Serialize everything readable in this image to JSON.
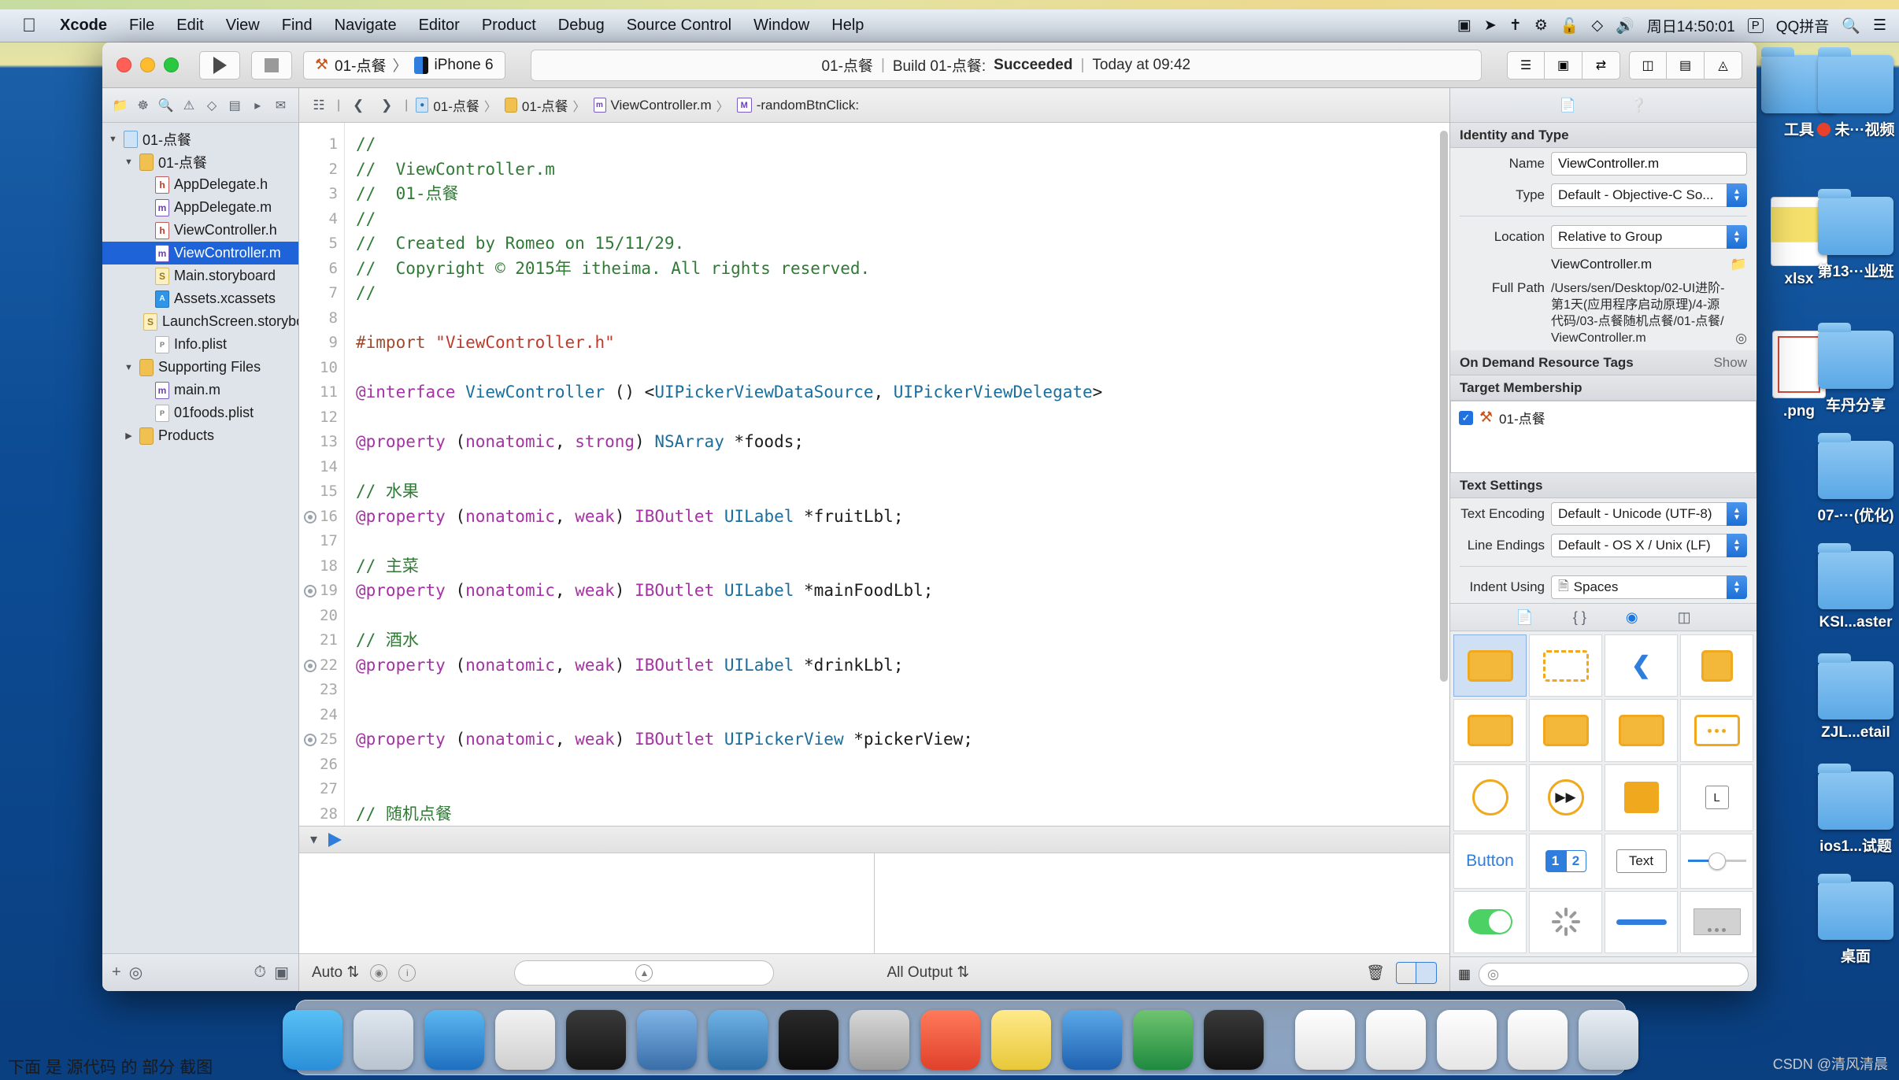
{
  "menubar": {
    "apple_icon": "apple-logo",
    "items": [
      "Xcode",
      "File",
      "Edit",
      "View",
      "Find",
      "Navigate",
      "Editor",
      "Product",
      "Debug",
      "Source Control",
      "Window",
      "Help"
    ],
    "status_icons": [
      "screen-recording-icon",
      "location-arrow-icon",
      "airplay-icon",
      "bluetooth-icon",
      "lock-icon",
      "dropbox-icon",
      "volume-icon"
    ],
    "clock": "周日14:50:01",
    "input_source": "QQ拼音",
    "input_badge": "P",
    "right_icons": [
      "search-icon",
      "control-center-icon"
    ]
  },
  "xcode": {
    "toolbar": {
      "run_icon": "play-icon",
      "stop_icon": "stop-icon",
      "scheme_name": "01-点餐",
      "scheme_sep": "〉",
      "destination": "iPhone 6",
      "status": {
        "project": "01-点餐",
        "sep1": "|",
        "action": "Build 01-点餐:",
        "result": "Succeeded",
        "sep2": "|",
        "time": "Today at 09:42"
      },
      "right_buttons": [
        "editor-standard-icon",
        "editor-assistant-icon",
        "editor-version-icon",
        "pane-navigator-icon",
        "pane-debug-icon",
        "pane-utilities-icon"
      ]
    },
    "navigator": {
      "tabs": [
        "folder-icon",
        "source-control-icon",
        "search-icon",
        "warning-icon",
        "breakpoint-icon",
        "tag-icon",
        "report-icon"
      ],
      "active_tab": 0,
      "tree": [
        {
          "label": "01-点餐",
          "depth": 0,
          "twisty": "▼",
          "icon": "proj",
          "selected": false
        },
        {
          "label": "01-点餐",
          "depth": 1,
          "twisty": "▼",
          "icon": "folder",
          "selected": false
        },
        {
          "label": "AppDelegate.h",
          "depth": 2,
          "twisty": "",
          "icon": "h",
          "selected": false
        },
        {
          "label": "AppDelegate.m",
          "depth": 2,
          "twisty": "",
          "icon": "m",
          "selected": false
        },
        {
          "label": "ViewController.h",
          "depth": 2,
          "twisty": "",
          "icon": "h",
          "selected": false
        },
        {
          "label": "ViewController.m",
          "depth": 2,
          "twisty": "",
          "icon": "m",
          "selected": true
        },
        {
          "label": "Main.storyboard",
          "depth": 2,
          "twisty": "",
          "icon": "sb",
          "selected": false
        },
        {
          "label": "Assets.xcassets",
          "depth": 2,
          "twisty": "",
          "icon": "xca",
          "selected": false
        },
        {
          "label": "LaunchScreen.storyboard",
          "depth": 2,
          "twisty": "",
          "icon": "sb",
          "selected": false
        },
        {
          "label": "Info.plist",
          "depth": 2,
          "twisty": "",
          "icon": "plist",
          "selected": false
        },
        {
          "label": "Supporting Files",
          "depth": 1,
          "twisty": "▼",
          "icon": "folder",
          "selected": false
        },
        {
          "label": "main.m",
          "depth": 2,
          "twisty": "",
          "icon": "m",
          "selected": false
        },
        {
          "label": "01foods.plist",
          "depth": 2,
          "twisty": "",
          "icon": "plist",
          "selected": false
        },
        {
          "label": "Products",
          "depth": 1,
          "twisty": "▶",
          "icon": "folder",
          "selected": false
        }
      ],
      "footer_icons": [
        "add-icon",
        "filter-icon",
        "recent-icon",
        "unsaved-icon"
      ]
    },
    "jumpbar": {
      "related_icon": "related-items-icon",
      "back_icon": "chevron-left-icon",
      "forward_icon": "chevron-right-icon",
      "crumbs": [
        "01-点餐",
        "01-点餐",
        "ViewController.m",
        "-randomBtnClick:"
      ],
      "sep": "〉"
    },
    "editor": {
      "first_line": 1,
      "breakpoint_lines": [
        16,
        19,
        22,
        25
      ],
      "lines": [
        "//",
        "//  ViewController.m",
        "//  01-点餐",
        "//",
        "//  Created by Romeo on 15/11/29.",
        "//  Copyright © 2015年 itheima. All rights reserved.",
        "//",
        "",
        "#import \"ViewController.h\"",
        "",
        "@interface ViewController () <UIPickerViewDataSource, UIPickerViewDelegate>",
        "",
        "@property (nonatomic, strong) NSArray *foods;",
        "",
        "// 水果",
        "@property (nonatomic, weak) IBOutlet UILabel *fruitLbl;",
        "",
        "// 主菜",
        "@property (nonatomic, weak) IBOutlet UILabel *mainFoodLbl;",
        "",
        "// 酒水",
        "@property (nonatomic, weak) IBOutlet UILabel *drinkLbl;",
        "",
        "",
        "@property (nonatomic, weak) IBOutlet UIPickerView *pickerView;",
        "",
        "",
        "// 随机点餐"
      ]
    },
    "debug_area": {
      "toolbar_icons": [
        "hide-console-icon",
        "continue-flag-icon"
      ],
      "variables_scope": "Auto",
      "scope_icons": [
        "record-icon",
        "info-icon"
      ],
      "filter_placeholder": "",
      "output_scope": "All Output",
      "trash_icon": "trash-icon",
      "split_icons": [
        "variables-pane-icon",
        "console-pane-icon"
      ]
    },
    "inspector": {
      "tabs": [
        "file-inspector-icon",
        "quick-help-icon"
      ],
      "active_tab": 0,
      "identity": {
        "title": "Identity and Type",
        "name_label": "Name",
        "name_value": "ViewController.m",
        "type_label": "Type",
        "type_value": "Default - Objective-C So...",
        "location_label": "Location",
        "location_value": "Relative to Group",
        "file_name": "ViewController.m",
        "full_path_label": "Full Path",
        "full_path_value": "/Users/sen/Desktop/02-UI进阶-第1天(应用程序启动原理)/4-源代码/03-点餐随机点餐/01-点餐/ViewController.m"
      },
      "on_demand": {
        "title": "On Demand Resource Tags",
        "show": "Show"
      },
      "target_membership": {
        "title": "Target Membership",
        "target": "01-点餐",
        "checked": true
      },
      "text_settings": {
        "title": "Text Settings",
        "encoding_label": "Text Encoding",
        "encoding_value": "Default - Unicode (UTF-8)",
        "endings_label": "Line Endings",
        "endings_value": "Default - OS X / Unix (LF)",
        "indent_label": "Indent Using",
        "indent_value": "Spaces"
      },
      "library": {
        "tabs": [
          "file-template-library-icon",
          "code-snippet-library-icon",
          "object-library-icon",
          "media-library-icon"
        ],
        "active_tab": 2,
        "items": [
          "view-object",
          "view-dashed",
          "navigation-back-button",
          "table-view",
          "collection-view",
          "toolbar-object",
          "page-control-object",
          "scroll-view",
          "image-view",
          "player-object",
          "cube-object",
          "label-badge",
          "button-control",
          "segmented-control",
          "text-field",
          "slider-control",
          "switch-control",
          "activity-indicator",
          "progress-view",
          "stepper-control"
        ],
        "button_label": "Button",
        "segment_labels": [
          "1",
          "2"
        ],
        "text_label": "Text",
        "segment_badge": "L",
        "search_placeholder": ""
      }
    }
  },
  "desktop": {
    "icons": [
      {
        "label": "工具",
        "type": "folder"
      },
      {
        "label": "未···视频",
        "type": "folder",
        "dot": true
      },
      {
        "label": "xlsx",
        "type": "xlsx"
      },
      {
        "label": "第13···业班",
        "type": "folder"
      },
      {
        "label": ".png",
        "type": "png"
      },
      {
        "label": "车丹分享",
        "type": "folder"
      },
      {
        "label": "07-···(优化)",
        "type": "folder"
      },
      {
        "label": "KSI...aster",
        "type": "folder"
      },
      {
        "label": "ZJL...etail",
        "type": "folder"
      },
      {
        "label": "ios1...试题",
        "type": "folder"
      },
      {
        "label": "桌面",
        "type": "folder"
      }
    ]
  },
  "dock": {
    "apps": [
      "finder-icon",
      "launchpad-icon",
      "safari-icon",
      "mouse-icon",
      "imovie-icon",
      "xcode-icon",
      "simulator-icon",
      "terminal-icon",
      "system-preferences-icon",
      "help-icon",
      "notes-icon",
      "word-icon",
      "excel-icon",
      "editor-icon"
    ],
    "docs": [
      "keynote-doc-icon",
      "keynote-doc-icon-2",
      "text-doc-icon",
      "presentation-doc-icon"
    ],
    "trash": "trash-icon"
  },
  "caption": "下面 是 源代码 的 部分 截图",
  "watermark": "CSDN @清风清晨"
}
